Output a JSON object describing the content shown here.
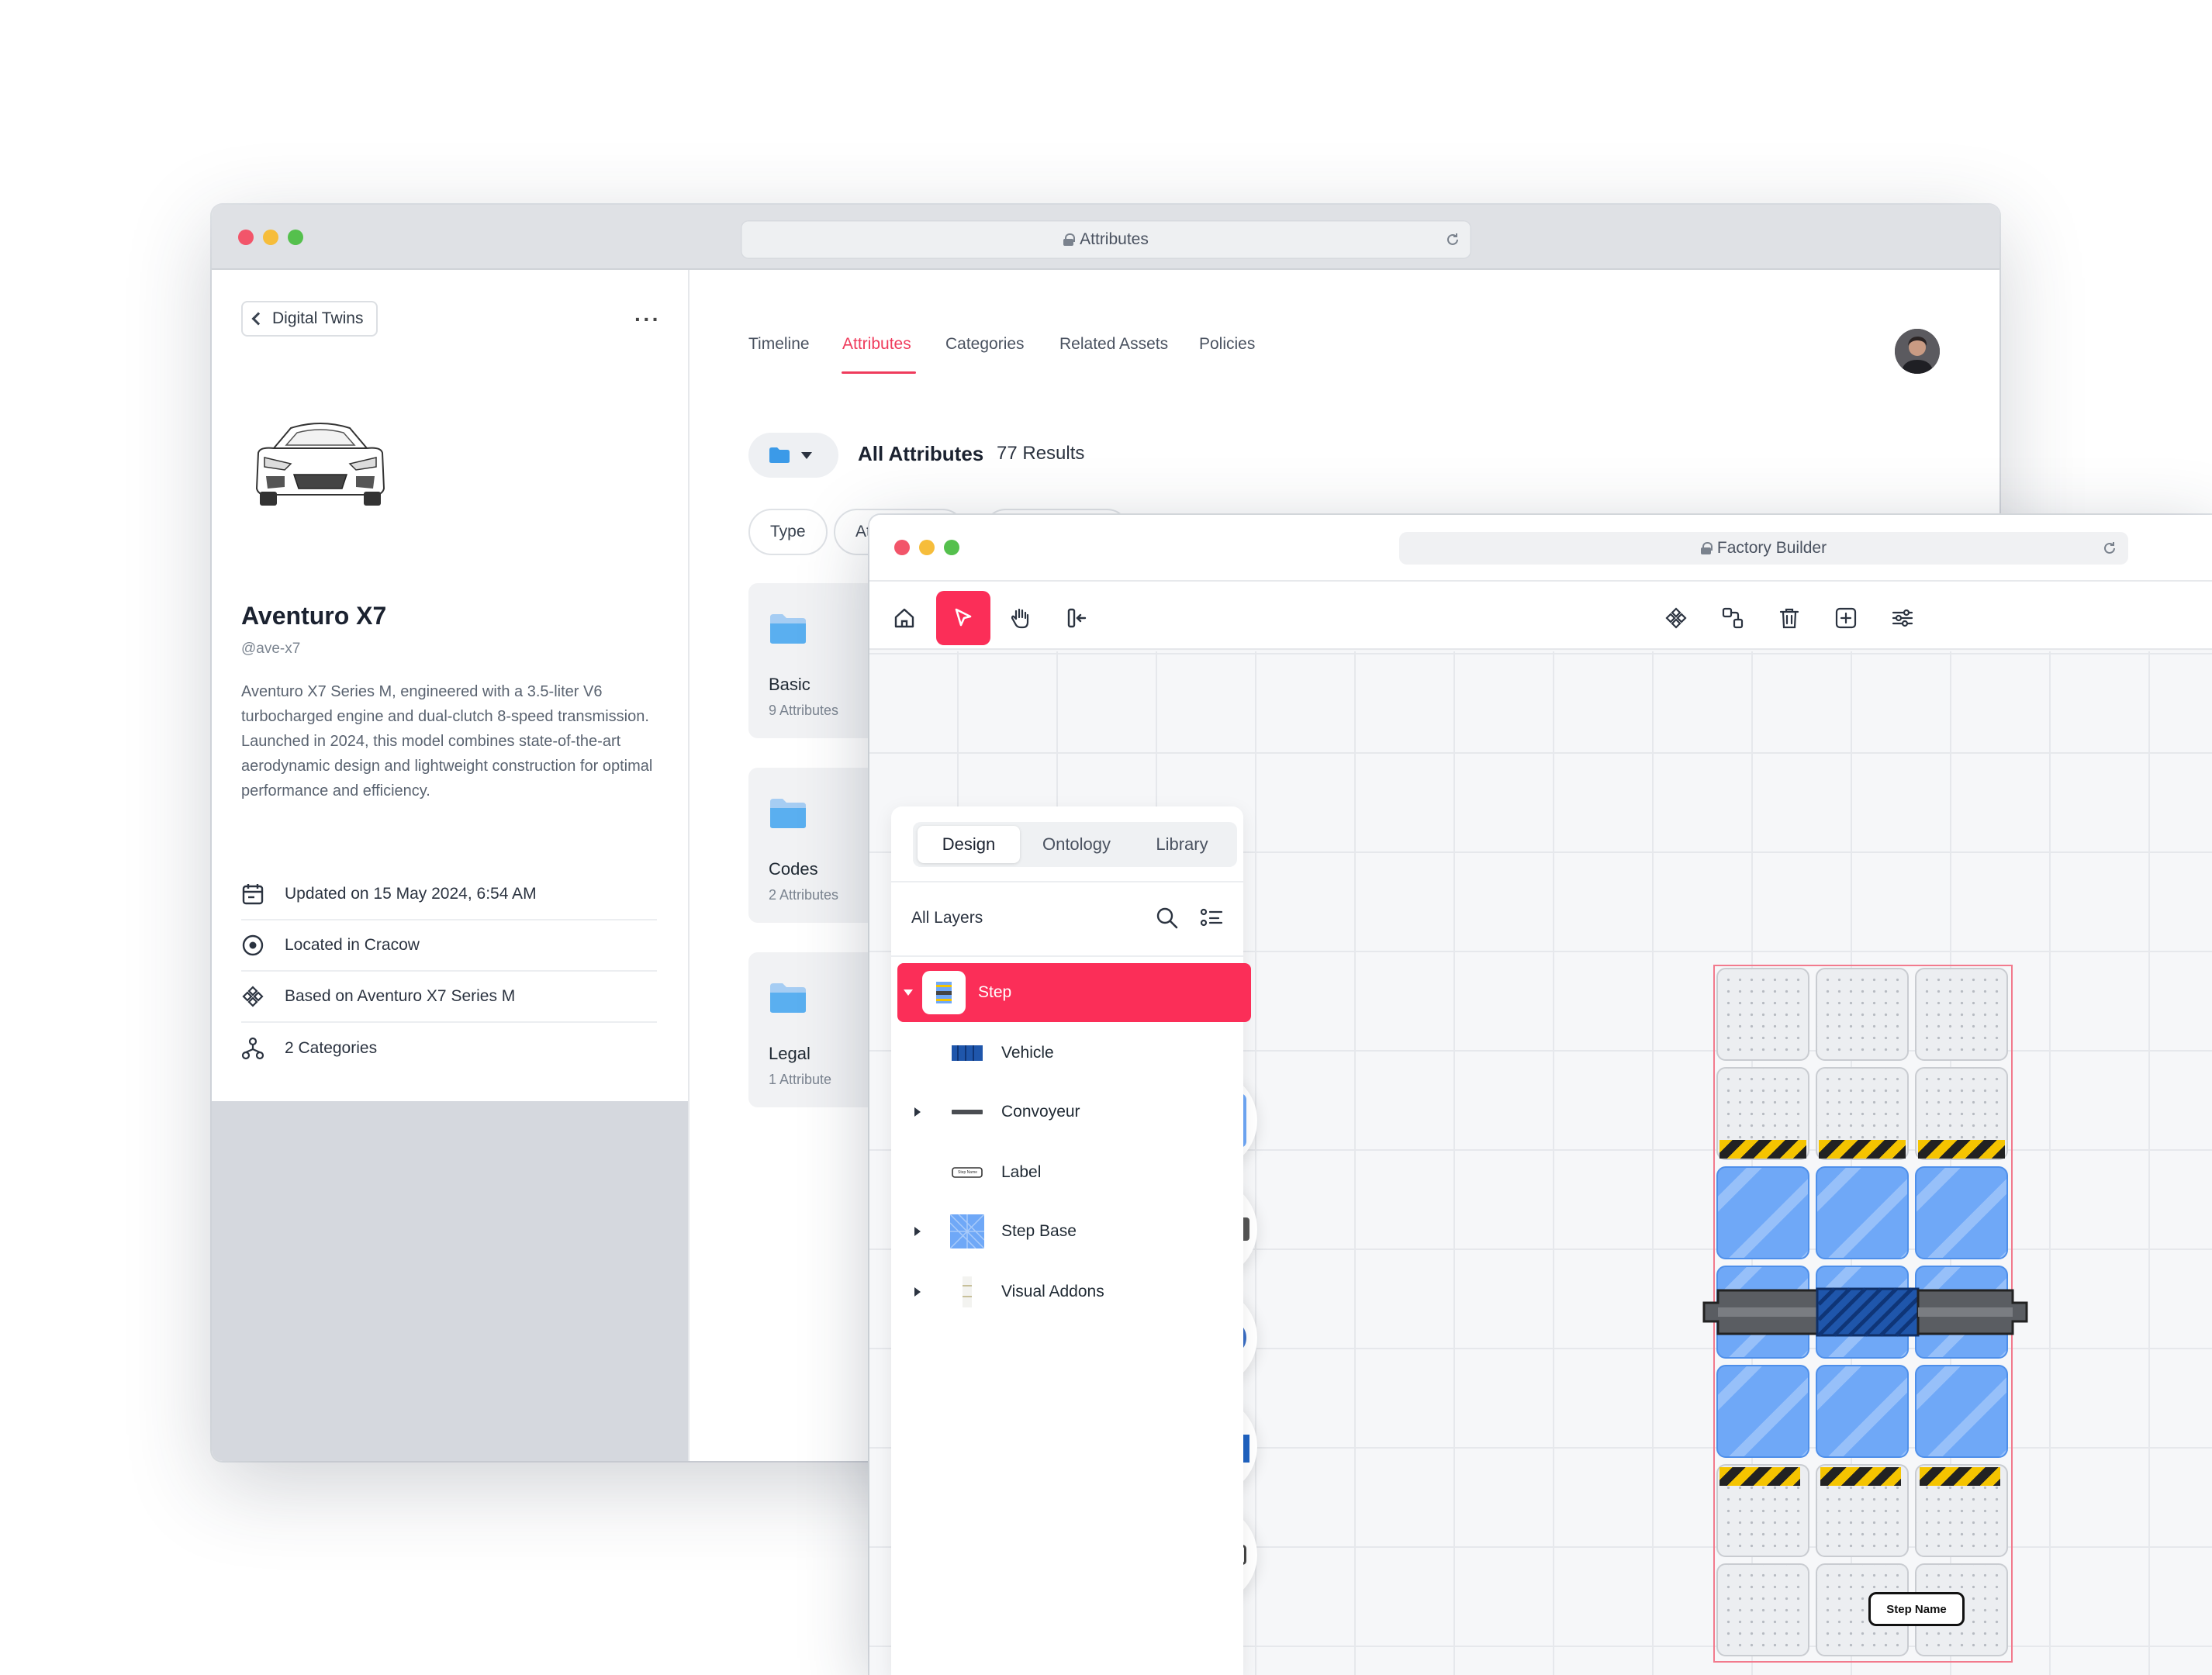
{
  "back_window": {
    "url": "Attributes",
    "sidebar": {
      "back_label": "Digital Twins",
      "more_label": "···",
      "title": "Aventuro X7",
      "handle": "@ave-x7",
      "description": "Aventuro X7 Series M, engineered with a 3.5-liter V6 turbocharged engine and dual-clutch 8-speed transmission. Launched in 2024, this model combines state-of-the-art aerodynamic design and lightweight construction for optimal performance and efficiency.",
      "meta": [
        {
          "icon": "calendar-icon",
          "text": "Updated on 15 May 2024, 6:54 AM"
        },
        {
          "icon": "location-icon",
          "text": "Located in Cracow"
        },
        {
          "icon": "components-icon",
          "text": "Based on Aventuro X7 Series M"
        },
        {
          "icon": "hierarchy-icon",
          "text": "2 Categories"
        }
      ]
    },
    "tabs": [
      "Timeline",
      "Attributes",
      "Categories",
      "Related Assets",
      "Policies"
    ],
    "active_tab": "Attributes",
    "heading": "All Attributes",
    "results": "77 Results",
    "filters": [
      "Type",
      "At"
    ],
    "cards": [
      {
        "title": "Basic",
        "subtitle": "9 Attributes"
      },
      {
        "title": "Codes",
        "subtitle": "2 Attributes"
      },
      {
        "title": "Legal",
        "subtitle": "1 Attribute"
      }
    ],
    "accent_color": "#ef3b5c"
  },
  "front_window": {
    "url": "Factory Builder",
    "toolbar_left": [
      "home-icon",
      "cursor-icon",
      "hand-icon",
      "insert-icon"
    ],
    "toolbar_right": [
      "components-icon",
      "group-icon",
      "trash-icon",
      "add-square-icon",
      "sliders-icon"
    ],
    "panel_tabs": [
      "Design",
      "Ontology",
      "Library"
    ],
    "active_panel_tab": "Design",
    "layers_heading": "All Layers",
    "layers": [
      {
        "label": "Step",
        "selected": true,
        "expandable": true
      },
      {
        "label": "Vehicle",
        "selected": false,
        "expandable": false
      },
      {
        "label": "Convoyeur",
        "selected": false,
        "expandable": true
      },
      {
        "label": "Label",
        "selected": false,
        "expandable": false
      },
      {
        "label": "Step Base",
        "selected": false,
        "expandable": true
      },
      {
        "label": "Visual Addons",
        "selected": false,
        "expandable": true
      }
    ],
    "canvas_label": "Step Name",
    "label_thumb_text": "Step Name",
    "accent_color": "#fb2e58"
  }
}
